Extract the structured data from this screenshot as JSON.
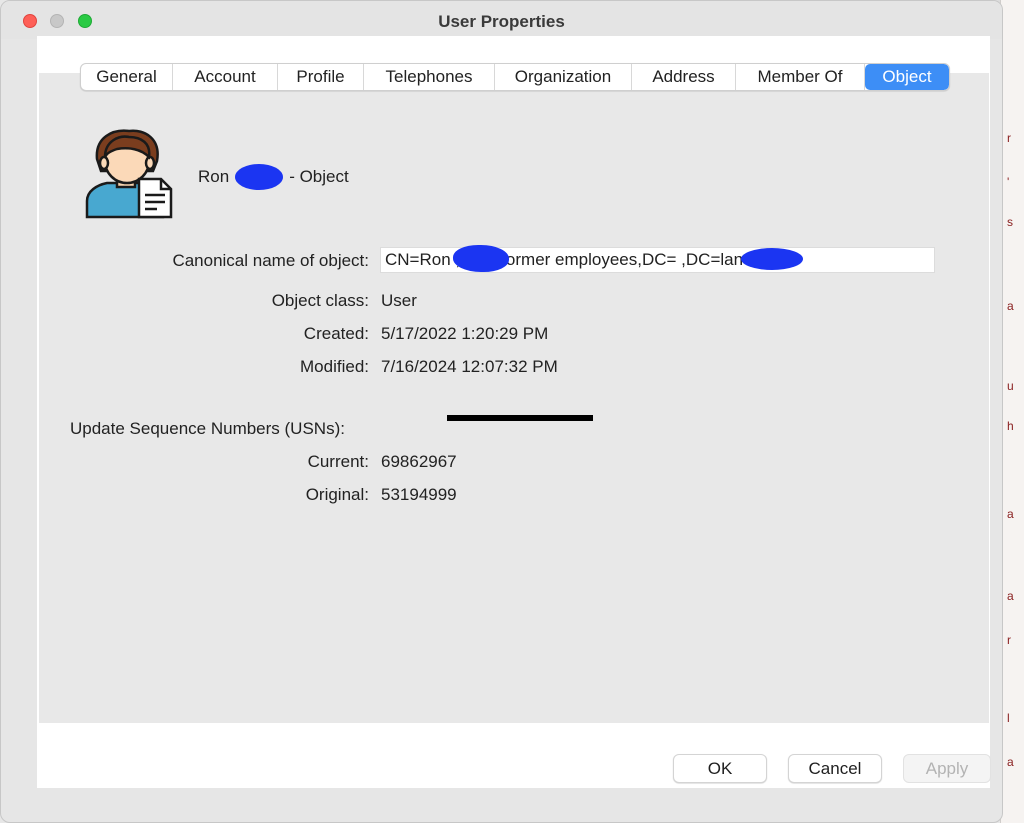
{
  "window": {
    "title": "User Properties"
  },
  "tabs": [
    {
      "label": "General"
    },
    {
      "label": "Account"
    },
    {
      "label": "Profile"
    },
    {
      "label": "Telephones"
    },
    {
      "label": "Organization"
    },
    {
      "label": "Address"
    },
    {
      "label": "Member Of"
    },
    {
      "label": "Object",
      "active": true
    }
  ],
  "object": {
    "first_name": "Ron",
    "suffix": "- Object"
  },
  "fields": {
    "canonical_label": "Canonical name of object:",
    "canonical_value": "CN=Ron       ,OU=Former employees,DC=          ,DC=lan",
    "class_label": "Object class:",
    "class_value": "User",
    "created_label": "Created:",
    "created_value": "5/17/2022 1:20:29 PM",
    "modified_label": "Modified:",
    "modified_value": "7/16/2024 12:07:32 PM"
  },
  "usn": {
    "heading": "Update Sequence Numbers (USNs):",
    "current_label": "Current:",
    "current_value": "69862967",
    "original_label": "Original:",
    "original_value": "53194999"
  },
  "buttons": {
    "ok": "OK",
    "cancel": "Cancel",
    "apply": "Apply"
  },
  "colors": {
    "accent": "#3d8ef6",
    "redaction": "#1b35f2"
  }
}
